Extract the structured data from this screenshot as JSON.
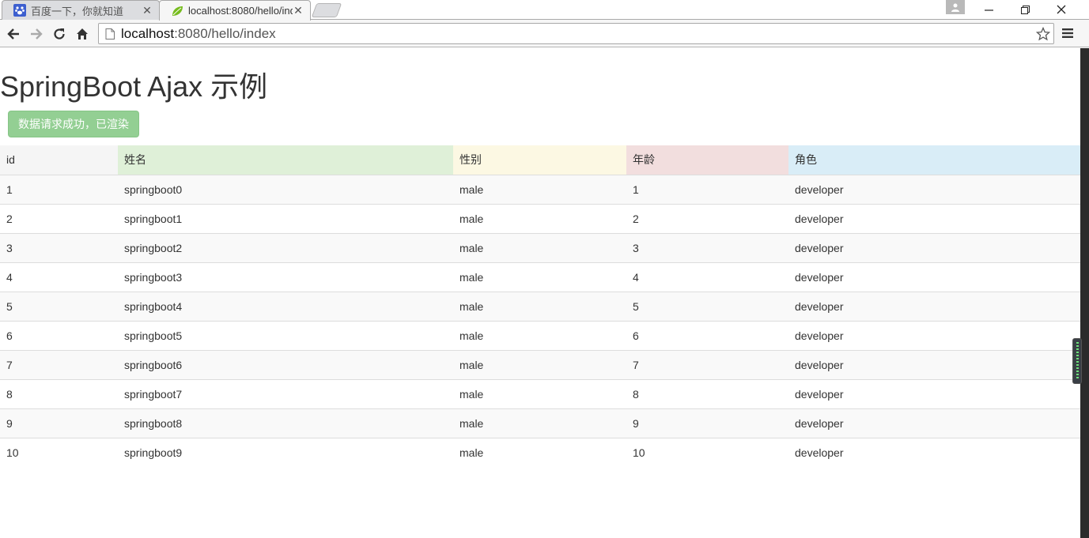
{
  "browser": {
    "tabs": [
      {
        "title": "百度一下，你就知道",
        "active": false
      },
      {
        "title": "localhost:8080/hello/ind",
        "active": true
      }
    ],
    "url_host": "localhost",
    "url_rest": ":8080/hello/index"
  },
  "page": {
    "title": "SpringBoot Ajax 示例",
    "status_button": "数据请求成功，已渲染"
  },
  "table": {
    "headers": [
      "id",
      "姓名",
      "性别",
      "年龄",
      "角色"
    ],
    "rows": [
      [
        "1",
        "springboot0",
        "male",
        "1",
        "developer"
      ],
      [
        "2",
        "springboot1",
        "male",
        "2",
        "developer"
      ],
      [
        "3",
        "springboot2",
        "male",
        "3",
        "developer"
      ],
      [
        "4",
        "springboot3",
        "male",
        "4",
        "developer"
      ],
      [
        "5",
        "springboot4",
        "male",
        "5",
        "developer"
      ],
      [
        "6",
        "springboot5",
        "male",
        "6",
        "developer"
      ],
      [
        "7",
        "springboot6",
        "male",
        "7",
        "developer"
      ],
      [
        "8",
        "springboot7",
        "male",
        "8",
        "developer"
      ],
      [
        "9",
        "springboot8",
        "male",
        "9",
        "developer"
      ],
      [
        "10",
        "springboot9",
        "male",
        "10",
        "developer"
      ]
    ]
  },
  "colors": {
    "header_id": "#f5f5f5",
    "header_name": "#dff0d8",
    "header_gender": "#fcf8e3",
    "header_age": "#f2dede",
    "header_role": "#d9edf7",
    "status_button": "#93cf93"
  },
  "icons": {
    "tab1": "baidu-paw-icon",
    "tab2": "spring-leaf-icon",
    "back": "back-arrow-icon",
    "forward": "forward-arrow-icon",
    "reload": "reload-icon",
    "home": "home-icon",
    "page": "page-icon",
    "bookmark": "star-icon",
    "menu": "hamburger-menu-icon"
  }
}
